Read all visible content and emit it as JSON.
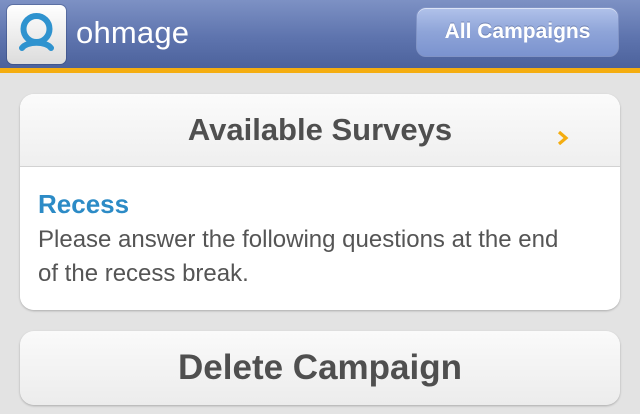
{
  "header": {
    "app_title": "ohmage",
    "nav_button_label": "All Campaigns",
    "logo_icon": "ohmage-logo-icon",
    "colors": {
      "bar": "#5e74ae",
      "accent_rule": "#f4ad10"
    }
  },
  "surveys": {
    "heading": "Available Surveys",
    "items": [
      {
        "title": "Recess",
        "description": "Please answer the following questions at the end of the recess break.",
        "icon": "chevron-right-icon"
      }
    ]
  },
  "actions": {
    "delete_label": "Delete Campaign"
  },
  "colors": {
    "survey_title": "#2c8bc6",
    "chevron": "#f4ad10"
  }
}
